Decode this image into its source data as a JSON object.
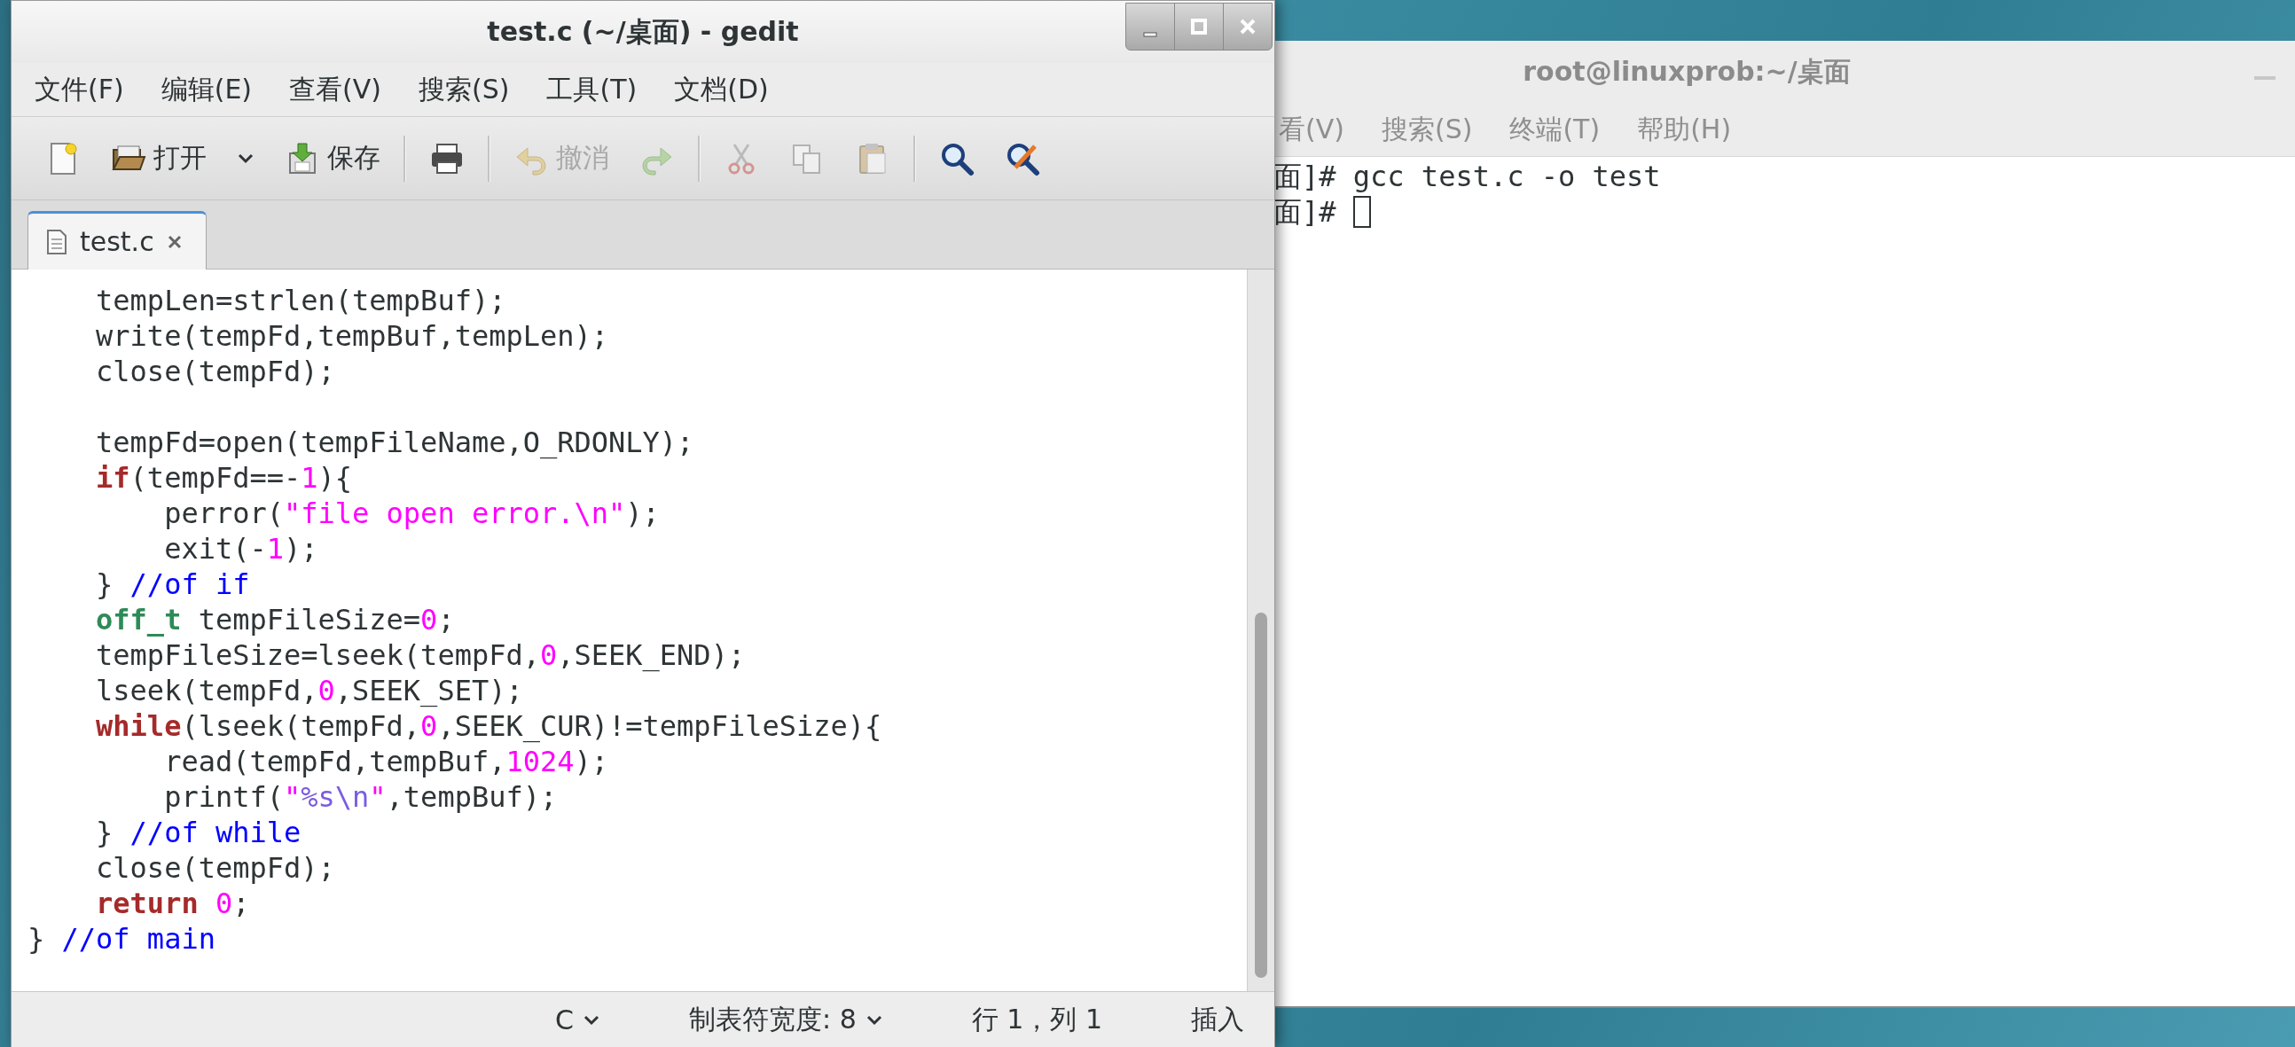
{
  "gedit": {
    "title": "test.c (~/桌面) - gedit",
    "menu": [
      "文件(F)",
      "编辑(E)",
      "查看(V)",
      "搜索(S)",
      "工具(T)",
      "文档(D)"
    ],
    "toolbar": [
      {
        "kind": "new",
        "disabled": false
      },
      {
        "kind": "open",
        "label": "打开",
        "disabled": false
      },
      {
        "kind": "menu",
        "disabled": false
      },
      {
        "kind": "save",
        "label": "保存",
        "disabled": false
      },
      {
        "kind": "separator"
      },
      {
        "kind": "print",
        "disabled": false
      },
      {
        "kind": "separator"
      },
      {
        "kind": "undo",
        "label": "撤消",
        "disabled": true
      },
      {
        "kind": "redo",
        "disabled": true
      },
      {
        "kind": "separator"
      },
      {
        "kind": "cut",
        "disabled": true
      },
      {
        "kind": "copy",
        "disabled": true
      },
      {
        "kind": "paste",
        "disabled": true
      },
      {
        "kind": "separator"
      },
      {
        "kind": "find",
        "disabled": false
      },
      {
        "kind": "replace",
        "disabled": false
      }
    ],
    "tabs": [
      {
        "label": "test.c",
        "selected": true
      }
    ],
    "code": [
      {
        "kind": "code",
        "segments": [
          {
            "text": "    tempLen=strlen(tempBuf);",
            "kind": "plain"
          }
        ]
      },
      {
        "kind": "code",
        "segments": [
          {
            "text": "    write(tempFd,tempBuf,tempLen);",
            "kind": "plain"
          }
        ]
      },
      {
        "kind": "code",
        "segments": [
          {
            "text": "    close(tempFd);",
            "kind": "plain"
          }
        ]
      },
      {
        "kind": "blank"
      },
      {
        "kind": "code",
        "segments": [
          {
            "text": "    tempFd=open(tempFileName,O_RDONLY);",
            "kind": "plain"
          }
        ]
      },
      {
        "kind": "code",
        "segments": [
          {
            "text": "    if",
            "kind": "keyword"
          },
          {
            "text": "(tempFd==-",
            "kind": "plain"
          },
          {
            "text": "1",
            "kind": "number"
          },
          {
            "text": "){",
            "kind": "plain"
          }
        ]
      },
      {
        "kind": "code",
        "segments": [
          {
            "text": "        perror(",
            "kind": "plain"
          },
          {
            "text": "\"file open error.\\n\"",
            "kind": "string"
          },
          {
            "text": ");",
            "kind": "plain"
          }
        ]
      },
      {
        "kind": "code",
        "segments": [
          {
            "text": "        exit(-",
            "kind": "plain"
          },
          {
            "text": "1",
            "kind": "number"
          },
          {
            "text": ");",
            "kind": "plain"
          }
        ]
      },
      {
        "kind": "code",
        "segments": [
          {
            "text": "    } ",
            "kind": "plain"
          },
          {
            "text": "//of if",
            "kind": "comment"
          }
        ]
      },
      {
        "kind": "code",
        "segments": [
          {
            "text": "    off_t",
            "kind": "type"
          },
          {
            "text": " tempFileSize=",
            "kind": "plain"
          },
          {
            "text": "0",
            "kind": "number"
          },
          {
            "text": ";",
            "kind": "plain"
          }
        ]
      },
      {
        "kind": "code",
        "segments": [
          {
            "text": "    tempFileSize=lseek(tempFd,",
            "kind": "plain"
          },
          {
            "text": "0",
            "kind": "number"
          },
          {
            "text": ",SEEK_END);",
            "kind": "plain"
          }
        ]
      },
      {
        "kind": "code",
        "segments": [
          {
            "text": "    lseek(tempFd,",
            "kind": "plain"
          },
          {
            "text": "0",
            "kind": "number"
          },
          {
            "text": ",SEEK_SET);",
            "kind": "plain"
          }
        ]
      },
      {
        "kind": "code",
        "segments": [
          {
            "text": "    while",
            "kind": "keyword"
          },
          {
            "text": "(lseek(tempFd,",
            "kind": "plain"
          },
          {
            "text": "0",
            "kind": "number"
          },
          {
            "text": ",SEEK_CUR)!=tempFileSize){",
            "kind": "plain"
          }
        ]
      },
      {
        "kind": "code",
        "segments": [
          {
            "text": "        read(tempFd,tempBuf,",
            "kind": "plain"
          },
          {
            "text": "1024",
            "kind": "number"
          },
          {
            "text": ");",
            "kind": "plain"
          }
        ]
      },
      {
        "kind": "code",
        "segments": [
          {
            "text": "        printf(",
            "kind": "plain"
          },
          {
            "text": "\"",
            "kind": "string"
          },
          {
            "text": "%s\\n",
            "kind": "format"
          },
          {
            "text": "\"",
            "kind": "string"
          },
          {
            "text": ",tempBuf);",
            "kind": "plain"
          }
        ]
      },
      {
        "kind": "code",
        "segments": [
          {
            "text": "    } ",
            "kind": "plain"
          },
          {
            "text": "//of while",
            "kind": "comment"
          }
        ]
      },
      {
        "kind": "code",
        "segments": [
          {
            "text": "    close(tempFd);",
            "kind": "plain"
          }
        ]
      },
      {
        "kind": "code",
        "segments": [
          {
            "text": "    return",
            "kind": "keyword"
          },
          {
            "text": " 0",
            "kind": "number"
          },
          {
            "text": ";",
            "kind": "plain"
          }
        ]
      },
      {
        "kind": "code",
        "segments": [
          {
            "text": "} ",
            "kind": "plain"
          },
          {
            "text": "//of main",
            "kind": "comment"
          }
        ]
      }
    ],
    "status_bar": [
      {
        "label": "C",
        "kind": "dropdown"
      },
      {
        "label": "制表符宽度: 8",
        "kind": "dropdown"
      },
      {
        "label": "行 1，列 1",
        "kind": "text"
      },
      {
        "label": "插入",
        "kind": "text"
      }
    ]
  },
  "terminal": {
    "title": "root@linuxprob:~/桌面",
    "menu": [
      "看(V)",
      "搜索(S)",
      "终端(T)",
      "帮助(H)"
    ],
    "lines": [
      {
        "text": "面]# gcc test.c -o test",
        "cursor": false
      },
      {
        "text": "面]# ",
        "cursor": true
      }
    ]
  }
}
